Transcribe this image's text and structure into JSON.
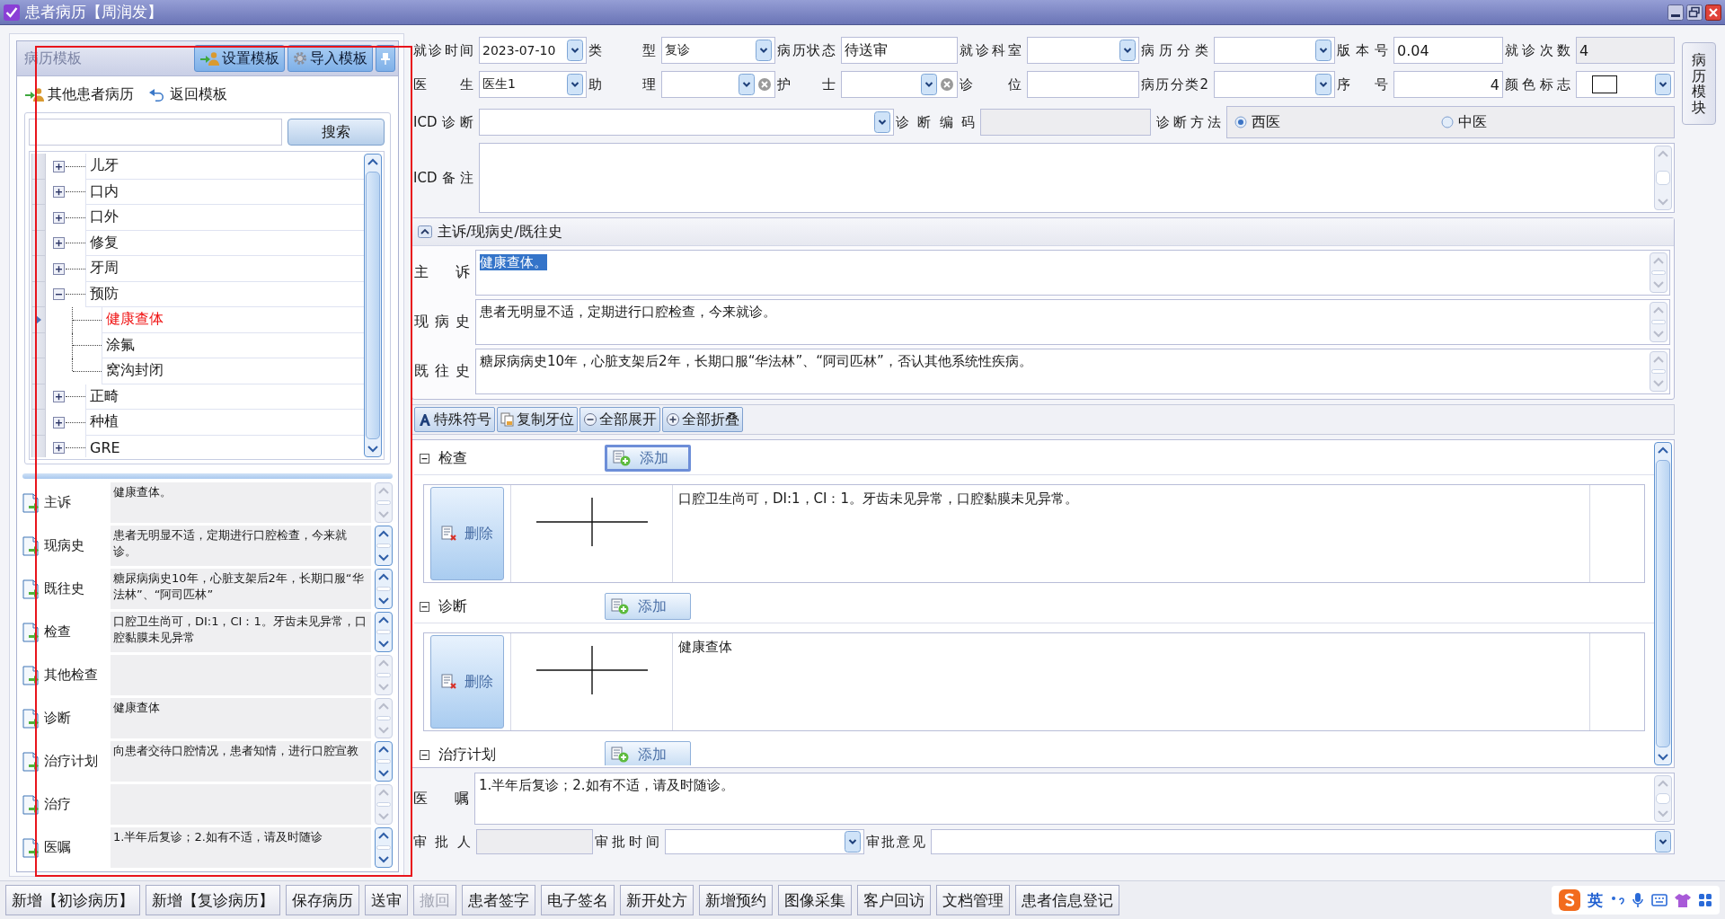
{
  "window": {
    "title": "患者病历【周润发】"
  },
  "template_panel": {
    "title": "病历模板",
    "buttons": [
      {
        "label": "设置模板",
        "kind": "person"
      },
      {
        "label": "导入模板",
        "kind": "gear"
      },
      {
        "kind": "pin"
      }
    ],
    "links": [
      {
        "label": "其他患者病历",
        "kind": "person"
      },
      {
        "label": "返回模板",
        "kind": "back"
      }
    ],
    "search": {
      "button": "搜索"
    },
    "tree": [
      {
        "label": "儿牙",
        "expanded": false,
        "selected": false
      },
      {
        "label": "口内",
        "expanded": false,
        "selected": false
      },
      {
        "label": "口外",
        "expanded": false,
        "selected": false
      },
      {
        "label": "修复",
        "expanded": false,
        "selected": false
      },
      {
        "label": "牙周",
        "expanded": false,
        "selected": false
      },
      {
        "label": "预防",
        "expanded": true,
        "selected": false,
        "children": [
          {
            "label": "健康查体",
            "selected": true
          },
          {
            "label": "涂氟",
            "selected": false
          },
          {
            "label": "窝沟封闭",
            "selected": false
          }
        ]
      },
      {
        "label": "正畸",
        "expanded": false,
        "selected": false
      },
      {
        "label": "种植",
        "expanded": false,
        "selected": false
      },
      {
        "label": "GRE",
        "expanded": false,
        "selected": false
      }
    ],
    "fields": [
      {
        "label": "主诉",
        "text": "健康查体。",
        "scrollable": false
      },
      {
        "label": "现病史",
        "text": "患者无明显不适，定期进行口腔检查，今来就诊。",
        "scrollable": true
      },
      {
        "label": "既往史",
        "text": "糖尿病病史10年，心脏支架后2年，长期口服“华法林”、“阿司匹林”",
        "scrollable": true
      },
      {
        "label": "检查",
        "text": "口腔卫生尚可，DI:1，CI：1。牙齿未见异常，口腔黏膜未见异常",
        "scrollable": true
      },
      {
        "label": "其他检查",
        "scrollable": false
      },
      {
        "label": "诊断",
        "text": "健康查体",
        "scrollable": false
      },
      {
        "label": "治疗计划",
        "text": "向患者交待口腔情况，患者知情，进行口腔宣教",
        "scrollable": true
      },
      {
        "label": "治疗",
        "scrollable": false
      },
      {
        "label": "医嘱",
        "text": "1.半年后复诊；2.如有不适，请及时随诊",
        "scrollable": true
      }
    ]
  },
  "side_tab": {
    "label": "病历模块"
  },
  "visit_form": {
    "rows": [
      [
        {
          "label": "就诊时间",
          "kind": "select",
          "value": "2023-07-10"
        },
        {
          "label": "类 型",
          "kind": "select",
          "value": "复诊"
        },
        {
          "label": "病历状态",
          "kind": "text",
          "value": "待送审"
        },
        {
          "label": "就诊科室",
          "kind": "select"
        },
        {
          "label": "病历分类",
          "kind": "select"
        },
        {
          "label": "版本号",
          "kind": "text",
          "value": "0.04"
        },
        {
          "label": "就诊次数",
          "kind": "readonly",
          "value": "4"
        }
      ],
      [
        {
          "label": "医 生",
          "kind": "select",
          "value": "医生1"
        },
        {
          "label": "助 理",
          "kind": "select_clear"
        },
        {
          "label": "护 士",
          "kind": "select_clear"
        },
        {
          "label": "诊 位",
          "kind": "text"
        },
        {
          "label": "病历分类2",
          "kind": "select"
        },
        {
          "label": "序号",
          "kind": "number",
          "value": "4"
        },
        {
          "label": "颜色标志",
          "kind": "color",
          "color": "#ffffff"
        }
      ]
    ],
    "icd": {
      "label": "ICD诊断"
    },
    "code": {
      "label": "诊断编码"
    },
    "method": {
      "label": "诊断方法",
      "options": [
        {
          "label": "西医",
          "selected": true
        },
        {
          "label": "中医",
          "selected": false
        }
      ]
    },
    "note": {
      "label": "ICD备注"
    }
  },
  "history": {
    "title": "主诉/现病史/既往史",
    "expanded": true,
    "fields": [
      {
        "label": "主 诉",
        "text": "健康查体。",
        "highlighted": true
      },
      {
        "label": "现 病 史",
        "text": "患者无明显不适，定期进行口腔检查，今来就诊。",
        "highlighted": false
      },
      {
        "label": "既 往 史",
        "text": "糖尿病病史10年，心脏支架后2年，长期口服“华法林”、“阿司匹林”，否认其他系统性疾病。",
        "highlighted": false
      }
    ]
  },
  "toolbar": [
    {
      "label": "特殊符号",
      "kind": "font"
    },
    {
      "label": "复制牙位",
      "kind": "copy"
    },
    {
      "label": "全部展开",
      "kind": "expand"
    },
    {
      "label": "全部折叠",
      "kind": "collapse"
    }
  ],
  "sections": [
    {
      "title": "检查",
      "expanded": true,
      "add_label": "添加",
      "focused": true,
      "entries": [
        {
          "delete_label": "删除",
          "text": "口腔卫生尚可，DI:1，CI：1。牙齿未见异常，口腔黏膜未见异常。"
        }
      ]
    },
    {
      "title": "诊断",
      "expanded": true,
      "add_label": "添加",
      "focused": false,
      "entries": [
        {
          "delete_label": "删除",
          "text": "健康查体"
        }
      ]
    },
    {
      "title": "治疗计划",
      "expanded": true,
      "add_label": "添加",
      "focused": false
    }
  ],
  "advice": {
    "label": "医 嘱",
    "text": "1.半年后复诊；2.如有不适，请及时随诊。"
  },
  "approval": [
    {
      "label": "审 批 人",
      "kind": "readonly"
    },
    {
      "label": "审批时间",
      "kind": "select"
    },
    {
      "label": "审批意见",
      "kind": "select"
    }
  ],
  "actions": [
    {
      "label": "新增【初诊病历】",
      "disabled": false
    },
    {
      "label": "新增【复诊病历】",
      "disabled": false
    },
    {
      "label": "保存病历",
      "disabled": false
    },
    {
      "label": "送审",
      "disabled": false
    },
    {
      "label": "撤回",
      "disabled": true
    },
    {
      "label": "患者签字",
      "disabled": false
    },
    {
      "label": "电子签名",
      "disabled": false
    },
    {
      "label": "新开处方",
      "disabled": false
    },
    {
      "label": "新增预约",
      "disabled": false
    },
    {
      "label": "图像采集",
      "disabled": false
    },
    {
      "label": "客户回访",
      "disabled": false
    },
    {
      "label": "文档管理",
      "disabled": false
    },
    {
      "label": "患者信息登记",
      "disabled": false
    }
  ],
  "ime": {
    "label": "英"
  },
  "annotation": {
    "kind": "frame"
  }
}
